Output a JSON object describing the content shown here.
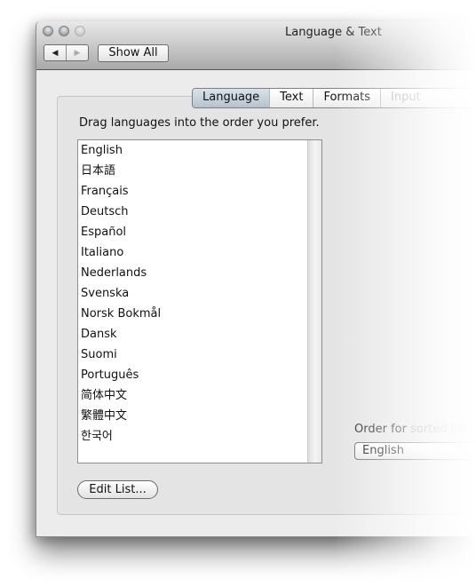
{
  "window": {
    "title": "Language & Text",
    "nav": {
      "back_icon": "◀",
      "forward_icon": "▶"
    },
    "show_all_label": "Show All"
  },
  "tabs": [
    {
      "label": "Language",
      "active": true
    },
    {
      "label": "Text",
      "active": false
    },
    {
      "label": "Formats",
      "active": false
    },
    {
      "label": "Input Sources",
      "active": false
    }
  ],
  "language_pane": {
    "instruction": "Drag languages into the order you prefer.",
    "languages": [
      "English",
      "日本語",
      "Français",
      "Deutsch",
      "Español",
      "Italiano",
      "Nederlands",
      "Svenska",
      "Norsk Bokmål",
      "Dansk",
      "Suomi",
      "Português",
      "简体中文",
      "繁體中文",
      "한국어"
    ],
    "edit_list_label": "Edit List...",
    "sort_order": {
      "label_start": "Order for ",
      "label_rest": "sorted lists",
      "selected": "English"
    }
  }
}
